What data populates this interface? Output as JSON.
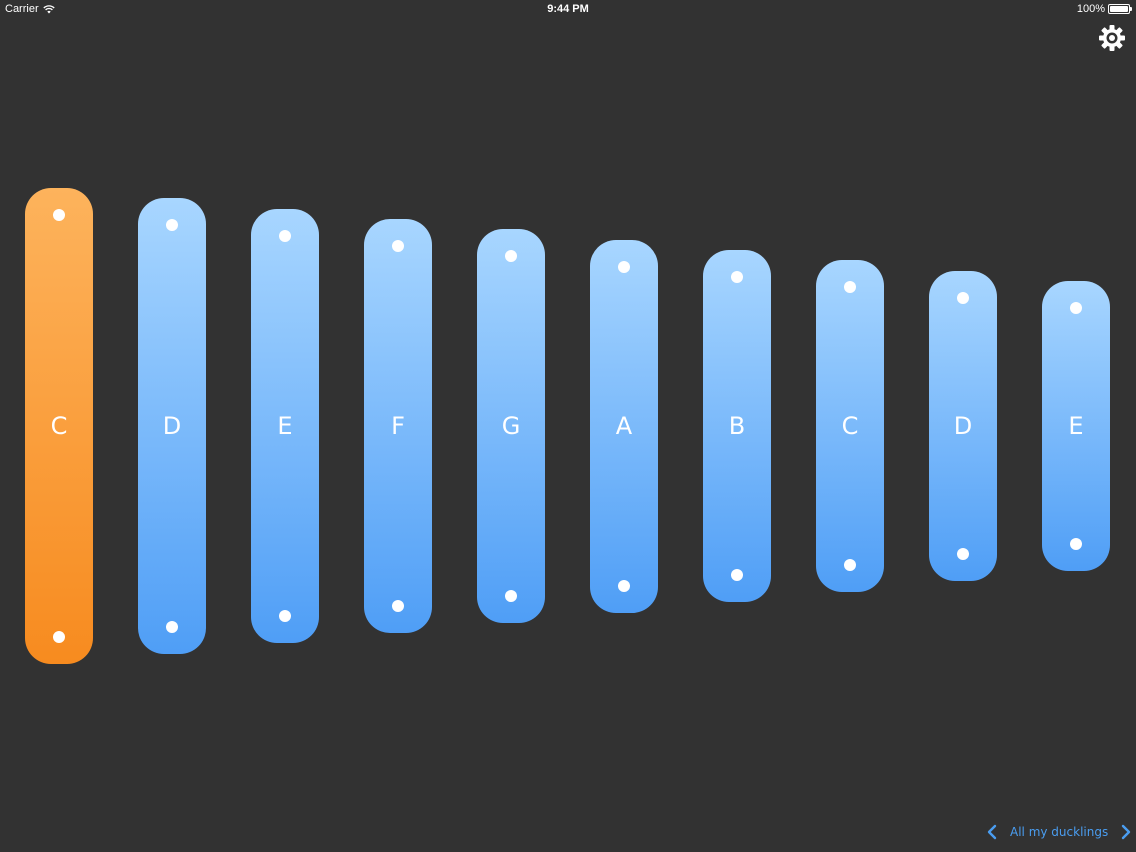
{
  "status_bar": {
    "carrier": "Carrier",
    "time": "9:44 PM",
    "battery": "100%",
    "battery_level": 1.0
  },
  "settings": {
    "icon": "gear-icon"
  },
  "xylophone": {
    "active_color": "#f78b1f",
    "bar_color": "#4f9ef6",
    "keys": [
      {
        "note": "C",
        "active": true
      },
      {
        "note": "D",
        "active": false
      },
      {
        "note": "E",
        "active": false
      },
      {
        "note": "F",
        "active": false
      },
      {
        "note": "G",
        "active": false
      },
      {
        "note": "A",
        "active": false
      },
      {
        "note": "B",
        "active": false
      },
      {
        "note": "C",
        "active": false
      },
      {
        "note": "D",
        "active": false
      },
      {
        "note": "E",
        "active": false
      }
    ]
  },
  "song_nav": {
    "title": "All my ducklings",
    "prev_icon": "chevron-left-icon",
    "next_icon": "chevron-right-icon"
  }
}
